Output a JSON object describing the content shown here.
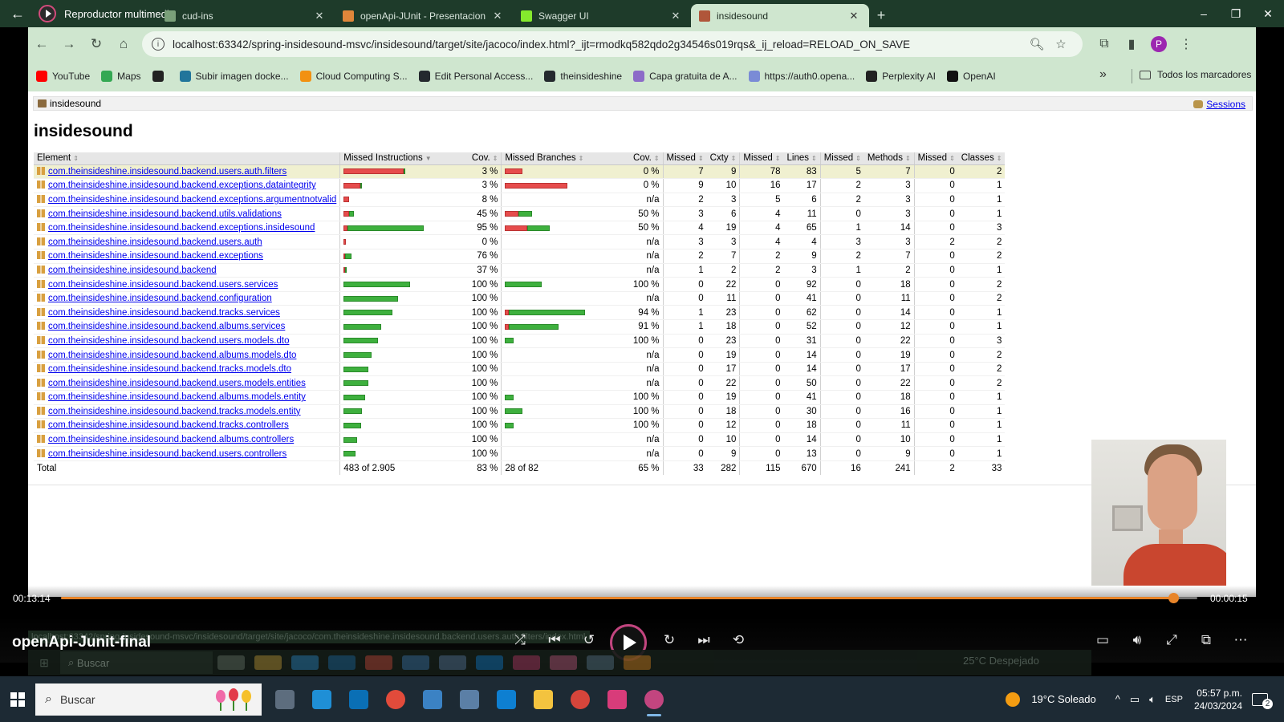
{
  "media_player": {
    "title": "Reproductor multimedia",
    "video_name": "openApi-Junit-final",
    "time_current": "00:13:14",
    "time_end": "00:00:15",
    "progress": 0.979
  },
  "browser": {
    "tabs": [
      {
        "label": "cud-ins",
        "color": "#7aa07a"
      },
      {
        "label": "openApi-JUnit - Presentacion",
        "color": "#e0863a"
      },
      {
        "label": "Swagger UI",
        "color": "#85ea2d"
      },
      {
        "label": "insidesound",
        "color": "#b0563a",
        "active": true
      }
    ],
    "url": "localhost:63342/spring-insidesound-msvc/insidesound/target/site/jacoco/index.html?_ijt=rmodkq582qdo2g34546s019rqs&_ij_reload=RELOAD_ON_SAVE",
    "profile_initial": "P",
    "bookmarks": [
      {
        "label": "YouTube",
        "color": "#ff0000"
      },
      {
        "label": "Maps",
        "color": "#34a853"
      },
      {
        "label": "",
        "color": "#222222"
      },
      {
        "label": "Subir imagen docke...",
        "color": "#21759b"
      },
      {
        "label": "Cloud Computing S...",
        "color": "#f29111"
      },
      {
        "label": "Edit Personal Access...",
        "color": "#24292e"
      },
      {
        "label": "theinsideshine",
        "color": "#24292e"
      },
      {
        "label": "Capa gratuita de A...",
        "color": "#8c6bc8"
      },
      {
        "label": "https://auth0.opena...",
        "color": "#7a8bd6"
      },
      {
        "label": "Perplexity AI",
        "color": "#222222"
      },
      {
        "label": "OpenAI",
        "color": "#111111"
      }
    ],
    "more_bookmarks": "»",
    "all_bookmarks": "Todos los marcadores"
  },
  "report": {
    "breadcrumb": "insidesound",
    "sessions": "Sessions",
    "title": "insidesound",
    "columns": [
      "Element",
      "Missed Instructions",
      "Cov.",
      "Missed Branches",
      "Cov.",
      "Missed",
      "Cxty",
      "Missed",
      "Lines",
      "Missed",
      "Methods",
      "Missed",
      "Classes"
    ],
    "rows": [
      {
        "element": "com.theinsideshine.insidesound.backend.users.auth.filters",
        "instr_cov": "3 %",
        "branch_cov": "0 %",
        "missed_cxty": "7",
        "cxty": "9",
        "missed_lines": "78",
        "lines": "83",
        "missed_methods": "5",
        "methods": "7",
        "missed_classes": "0",
        "classes": "2",
        "ib_red": 75,
        "ib_green": 2,
        "bb_red": 22,
        "bb_green": 0
      },
      {
        "element": "com.theinsideshine.insidesound.backend.exceptions.dataintegrity",
        "instr_cov": "3 %",
        "branch_cov": "0 %",
        "missed_cxty": "9",
        "cxty": "10",
        "missed_lines": "16",
        "lines": "17",
        "missed_methods": "2",
        "methods": "3",
        "missed_classes": "0",
        "classes": "1",
        "ib_red": 21,
        "ib_green": 1,
        "bb_red": 78,
        "bb_green": 0
      },
      {
        "element": "com.theinsideshine.insidesound.backend.exceptions.argumentnotvalid",
        "instr_cov": "8 %",
        "branch_cov": "n/a",
        "missed_cxty": "2",
        "cxty": "3",
        "missed_lines": "5",
        "lines": "6",
        "missed_methods": "2",
        "methods": "3",
        "missed_classes": "0",
        "classes": "1",
        "ib_red": 7,
        "ib_green": 0,
        "bb_red": 0,
        "bb_green": 0
      },
      {
        "element": "com.theinsideshine.insidesound.backend.utils.validations",
        "instr_cov": "45 %",
        "branch_cov": "50 %",
        "missed_cxty": "3",
        "cxty": "6",
        "missed_lines": "4",
        "lines": "11",
        "missed_methods": "0",
        "methods": "3",
        "missed_classes": "0",
        "classes": "1",
        "ib_red": 7,
        "ib_green": 6,
        "bb_red": 17,
        "bb_green": 17
      },
      {
        "element": "com.theinsideshine.insidesound.backend.exceptions.insidesound",
        "instr_cov": "95 %",
        "branch_cov": "50 %",
        "missed_cxty": "4",
        "cxty": "19",
        "missed_lines": "4",
        "lines": "65",
        "missed_methods": "1",
        "methods": "14",
        "missed_classes": "0",
        "classes": "3",
        "ib_red": 5,
        "ib_green": 95,
        "bb_red": 28,
        "bb_green": 28
      },
      {
        "element": "com.theinsideshine.insidesound.backend.users.auth",
        "instr_cov": "0 %",
        "branch_cov": "n/a",
        "missed_cxty": "3",
        "cxty": "3",
        "missed_lines": "4",
        "lines": "4",
        "missed_methods": "3",
        "methods": "3",
        "missed_classes": "2",
        "classes": "2",
        "ib_red": 3,
        "ib_green": 0,
        "bb_red": 0,
        "bb_green": 0
      },
      {
        "element": "com.theinsideshine.insidesound.backend.exceptions",
        "instr_cov": "76 %",
        "branch_cov": "n/a",
        "missed_cxty": "2",
        "cxty": "7",
        "missed_lines": "2",
        "lines": "9",
        "missed_methods": "2",
        "methods": "7",
        "missed_classes": "0",
        "classes": "2",
        "ib_red": 2,
        "ib_green": 8,
        "bb_red": 0,
        "bb_green": 0
      },
      {
        "element": "com.theinsideshine.insidesound.backend",
        "instr_cov": "37 %",
        "branch_cov": "n/a",
        "missed_cxty": "1",
        "cxty": "2",
        "missed_lines": "2",
        "lines": "3",
        "missed_methods": "1",
        "methods": "2",
        "missed_classes": "0",
        "classes": "1",
        "ib_red": 1,
        "ib_green": 1,
        "bb_red": 0,
        "bb_green": 0
      },
      {
        "element": "com.theinsideshine.insidesound.backend.users.services",
        "instr_cov": "100 %",
        "branch_cov": "100 %",
        "missed_cxty": "0",
        "cxty": "22",
        "missed_lines": "0",
        "lines": "92",
        "missed_methods": "0",
        "methods": "18",
        "missed_classes": "0",
        "classes": "2",
        "ib_red": 0,
        "ib_green": 83,
        "bb_red": 0,
        "bb_green": 46
      },
      {
        "element": "com.theinsideshine.insidesound.backend.configuration",
        "instr_cov": "100 %",
        "branch_cov": "n/a",
        "missed_cxty": "0",
        "cxty": "11",
        "missed_lines": "0",
        "lines": "41",
        "missed_methods": "0",
        "methods": "11",
        "missed_classes": "0",
        "classes": "2",
        "ib_red": 0,
        "ib_green": 68,
        "bb_red": 0,
        "bb_green": 0
      },
      {
        "element": "com.theinsideshine.insidesound.backend.tracks.services",
        "instr_cov": "100 %",
        "branch_cov": "94 %",
        "missed_cxty": "1",
        "cxty": "23",
        "missed_lines": "0",
        "lines": "62",
        "missed_methods": "0",
        "methods": "14",
        "missed_classes": "0",
        "classes": "1",
        "ib_red": 0,
        "ib_green": 61,
        "bb_red": 5,
        "bb_green": 95
      },
      {
        "element": "com.theinsideshine.insidesound.backend.albums.services",
        "instr_cov": "100 %",
        "branch_cov": "91 %",
        "missed_cxty": "1",
        "cxty": "18",
        "missed_lines": "0",
        "lines": "52",
        "missed_methods": "0",
        "methods": "12",
        "missed_classes": "0",
        "classes": "1",
        "ib_red": 0,
        "ib_green": 47,
        "bb_red": 5,
        "bb_green": 62
      },
      {
        "element": "com.theinsideshine.insidesound.backend.users.models.dto",
        "instr_cov": "100 %",
        "branch_cov": "100 %",
        "missed_cxty": "0",
        "cxty": "23",
        "missed_lines": "0",
        "lines": "31",
        "missed_methods": "0",
        "methods": "22",
        "missed_classes": "0",
        "classes": "3",
        "ib_red": 0,
        "ib_green": 43,
        "bb_red": 0,
        "bb_green": 11
      },
      {
        "element": "com.theinsideshine.insidesound.backend.albums.models.dto",
        "instr_cov": "100 %",
        "branch_cov": "n/a",
        "missed_cxty": "0",
        "cxty": "19",
        "missed_lines": "0",
        "lines": "14",
        "missed_methods": "0",
        "methods": "19",
        "missed_classes": "0",
        "classes": "2",
        "ib_red": 0,
        "ib_green": 35,
        "bb_red": 0,
        "bb_green": 0
      },
      {
        "element": "com.theinsideshine.insidesound.backend.tracks.models.dto",
        "instr_cov": "100 %",
        "branch_cov": "n/a",
        "missed_cxty": "0",
        "cxty": "17",
        "missed_lines": "0",
        "lines": "14",
        "missed_methods": "0",
        "methods": "17",
        "missed_classes": "0",
        "classes": "2",
        "ib_red": 0,
        "ib_green": 31,
        "bb_red": 0,
        "bb_green": 0
      },
      {
        "element": "com.theinsideshine.insidesound.backend.users.models.entities",
        "instr_cov": "100 %",
        "branch_cov": "n/a",
        "missed_cxty": "0",
        "cxty": "22",
        "missed_lines": "0",
        "lines": "50",
        "missed_methods": "0",
        "methods": "22",
        "missed_classes": "0",
        "classes": "2",
        "ib_red": 0,
        "ib_green": 31,
        "bb_red": 0,
        "bb_green": 0
      },
      {
        "element": "com.theinsideshine.insidesound.backend.albums.models.entity",
        "instr_cov": "100 %",
        "branch_cov": "100 %",
        "missed_cxty": "0",
        "cxty": "19",
        "missed_lines": "0",
        "lines": "41",
        "missed_methods": "0",
        "methods": "18",
        "missed_classes": "0",
        "classes": "1",
        "ib_red": 0,
        "ib_green": 27,
        "bb_red": 0,
        "bb_green": 11
      },
      {
        "element": "com.theinsideshine.insidesound.backend.tracks.models.entity",
        "instr_cov": "100 %",
        "branch_cov": "100 %",
        "missed_cxty": "0",
        "cxty": "18",
        "missed_lines": "0",
        "lines": "30",
        "missed_methods": "0",
        "methods": "16",
        "missed_classes": "0",
        "classes": "1",
        "ib_red": 0,
        "ib_green": 23,
        "bb_red": 0,
        "bb_green": 22
      },
      {
        "element": "com.theinsideshine.insidesound.backend.tracks.controllers",
        "instr_cov": "100 %",
        "branch_cov": "100 %",
        "missed_cxty": "0",
        "cxty": "12",
        "missed_lines": "0",
        "lines": "18",
        "missed_methods": "0",
        "methods": "11",
        "missed_classes": "0",
        "classes": "1",
        "ib_red": 0,
        "ib_green": 22,
        "bb_red": 0,
        "bb_green": 11
      },
      {
        "element": "com.theinsideshine.insidesound.backend.albums.controllers",
        "instr_cov": "100 %",
        "branch_cov": "n/a",
        "missed_cxty": "0",
        "cxty": "10",
        "missed_lines": "0",
        "lines": "14",
        "missed_methods": "0",
        "methods": "10",
        "missed_classes": "0",
        "classes": "1",
        "ib_red": 0,
        "ib_green": 17,
        "bb_red": 0,
        "bb_green": 0
      },
      {
        "element": "com.theinsideshine.insidesound.backend.users.controllers",
        "instr_cov": "100 %",
        "branch_cov": "n/a",
        "missed_cxty": "0",
        "cxty": "9",
        "missed_lines": "0",
        "lines": "13",
        "missed_methods": "0",
        "methods": "9",
        "missed_classes": "0",
        "classes": "1",
        "ib_red": 0,
        "ib_green": 15,
        "bb_red": 0,
        "bb_green": 0
      }
    ],
    "total": {
      "element": "Total",
      "missed_instr": "483 of 2.905",
      "instr_cov": "83 %",
      "missed_branches": "28 of 82",
      "branch_cov": "65 %",
      "missed_cxty": "33",
      "cxty": "282",
      "missed_lines": "115",
      "lines": "670",
      "missed_methods": "16",
      "methods": "241",
      "missed_classes": "2",
      "classes": "33"
    }
  },
  "inner_taskbar": {
    "search": "Buscar",
    "weather": "25°C  Despejado"
  },
  "taskbar": {
    "search": "Buscar",
    "weather": "19°C  Soleado",
    "language": "ESP",
    "time": "05:57 p.m.",
    "date": "24/03/2024",
    "notifications": "2",
    "apps": [
      {
        "name": "task-view",
        "color": "#5d6d7e"
      },
      {
        "name": "edge",
        "color": "#1f8fd6"
      },
      {
        "name": "app-blue",
        "color": "#0a6fb5"
      },
      {
        "name": "chrome",
        "color": "#e24b3b"
      },
      {
        "name": "app-azure",
        "color": "#3b82c4"
      },
      {
        "name": "postgres",
        "color": "#5b7fa6"
      },
      {
        "name": "vscode",
        "color": "#0e7fd1"
      },
      {
        "name": "explorer",
        "color": "#f3c33f"
      },
      {
        "name": "chrome-profile",
        "color": "#d6453b"
      },
      {
        "name": "intellij",
        "color": "#d83c7a"
      },
      {
        "name": "media-player",
        "color": "#c2457f"
      }
    ]
  }
}
